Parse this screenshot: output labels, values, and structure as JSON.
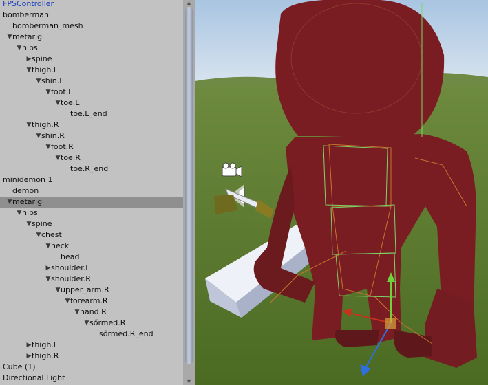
{
  "hierarchy": {
    "items": [
      {
        "label": "FPSController",
        "depth": 0,
        "arrow": "",
        "blue": true
      },
      {
        "label": "bomberman",
        "depth": 0,
        "arrow": ""
      },
      {
        "label": "bomberman_mesh",
        "depth": 1,
        "arrow": ""
      },
      {
        "label": "metarig",
        "depth": 1,
        "arrow": "down"
      },
      {
        "label": "hips",
        "depth": 2,
        "arrow": "down"
      },
      {
        "label": "spine",
        "depth": 3,
        "arrow": "right"
      },
      {
        "label": "thigh.L",
        "depth": 3,
        "arrow": "down"
      },
      {
        "label": "shin.L",
        "depth": 4,
        "arrow": "down"
      },
      {
        "label": "foot.L",
        "depth": 5,
        "arrow": "down"
      },
      {
        "label": "toe.L",
        "depth": 6,
        "arrow": "down"
      },
      {
        "label": "toe.L_end",
        "depth": 7,
        "arrow": ""
      },
      {
        "label": "thigh.R",
        "depth": 3,
        "arrow": "down"
      },
      {
        "label": "shin.R",
        "depth": 4,
        "arrow": "down"
      },
      {
        "label": "foot.R",
        "depth": 5,
        "arrow": "down"
      },
      {
        "label": "toe.R",
        "depth": 6,
        "arrow": "down"
      },
      {
        "label": "toe.R_end",
        "depth": 7,
        "arrow": ""
      },
      {
        "label": "minidemon 1",
        "depth": 0,
        "arrow": ""
      },
      {
        "label": "demon",
        "depth": 1,
        "arrow": ""
      },
      {
        "label": "metarig",
        "depth": 1,
        "arrow": "down",
        "selected": true
      },
      {
        "label": "hips",
        "depth": 2,
        "arrow": "down"
      },
      {
        "label": "spine",
        "depth": 3,
        "arrow": "down"
      },
      {
        "label": "chest",
        "depth": 4,
        "arrow": "down"
      },
      {
        "label": "neck",
        "depth": 5,
        "arrow": "down"
      },
      {
        "label": "head",
        "depth": 6,
        "arrow": ""
      },
      {
        "label": "shoulder.L",
        "depth": 5,
        "arrow": "right"
      },
      {
        "label": "shoulder.R",
        "depth": 5,
        "arrow": "down"
      },
      {
        "label": "upper_arm.R",
        "depth": 6,
        "arrow": "down"
      },
      {
        "label": "forearm.R",
        "depth": 7,
        "arrow": "down"
      },
      {
        "label": "hand.R",
        "depth": 8,
        "arrow": "down"
      },
      {
        "label": "sőrmed.R",
        "depth": 9,
        "arrow": "down"
      },
      {
        "label": "sőrmed.R_end",
        "depth": 10,
        "arrow": ""
      },
      {
        "label": "thigh.L",
        "depth": 3,
        "arrow": "right"
      },
      {
        "label": "thigh.R",
        "depth": 3,
        "arrow": "right"
      },
      {
        "label": "Cube (1)",
        "depth": 0,
        "arrow": ""
      },
      {
        "label": "Directional Light",
        "depth": 0,
        "arrow": ""
      }
    ]
  },
  "scene": {
    "gizmo_icons": [
      "camera-gizmo-icon",
      "audio-source-gizmo-icon"
    ],
    "colors": {
      "sky": "#bcd3e9",
      "grass": "#5b7a2c",
      "demon": "#7a1d22",
      "cube": "#c9cfe0",
      "bone_lines": "#c8742e",
      "collider": "#7bd66a"
    }
  }
}
